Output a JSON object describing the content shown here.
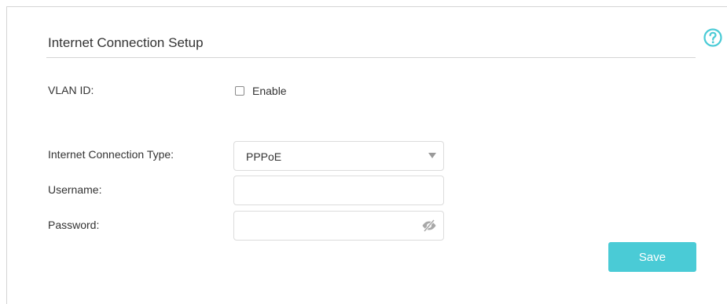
{
  "section": {
    "title": "Internet Connection Setup"
  },
  "help": {
    "icon": "question-circle-icon",
    "color": "#4acbd6"
  },
  "vlan": {
    "label": "VLAN ID:",
    "checkbox_label": "Enable",
    "checked": false
  },
  "connection_type": {
    "label": "Internet Connection Type:",
    "selected": "PPPoE",
    "icon": "dropdown-arrow-icon"
  },
  "username": {
    "label": "Username:",
    "value": ""
  },
  "password": {
    "label": "Password:",
    "value": "",
    "icon": "eye-hidden-icon"
  },
  "actions": {
    "save_label": "Save",
    "save_color": "#4acbd6"
  }
}
